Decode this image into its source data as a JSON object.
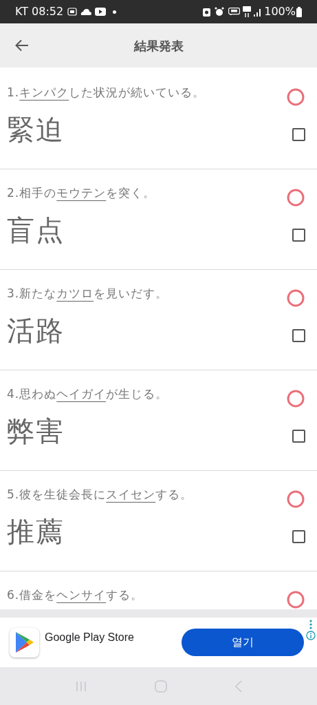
{
  "status_bar": {
    "carrier_time": "KT 08:52",
    "battery": "100%"
  },
  "app_bar": {
    "title": "結果発表"
  },
  "questions": [
    {
      "number": "1.",
      "target": "キンパク",
      "suffix": "した状況が続いている。",
      "answer": "緊迫",
      "correct": true,
      "checked": false
    },
    {
      "number": "2.",
      "prefix": "相手の",
      "target": "モウテン",
      "suffix": "を突く。",
      "answer": "盲点",
      "correct": true,
      "checked": false
    },
    {
      "number": "3.",
      "prefix": "新たな",
      "target": "カツロ",
      "suffix": "を見いだす。",
      "answer": "活路",
      "correct": true,
      "checked": false
    },
    {
      "number": "4.",
      "prefix": "思わぬ",
      "target": "ヘイガイ",
      "suffix": "が生じる。",
      "answer": "弊害",
      "correct": true,
      "checked": false
    },
    {
      "number": "5.",
      "prefix": "彼を生徒会長に",
      "target": "スイセン",
      "suffix": "する。",
      "answer": "推薦",
      "correct": true,
      "checked": false
    },
    {
      "number": "6.",
      "prefix": "借金を",
      "target": "ヘンサイ",
      "suffix": "する。",
      "correct": true
    }
  ],
  "ad": {
    "app_name": "Google Play Store",
    "button": "열기"
  }
}
